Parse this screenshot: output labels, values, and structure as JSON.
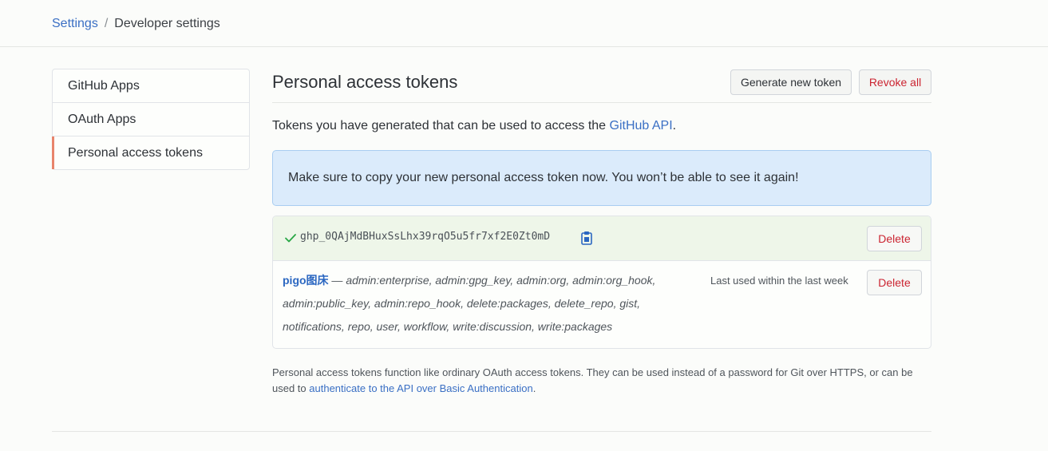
{
  "breadcrumb": {
    "parent": "Settings",
    "separator": "/",
    "current": "Developer settings"
  },
  "sidebar": {
    "items": [
      {
        "label": "GitHub Apps",
        "active": false
      },
      {
        "label": "OAuth Apps",
        "active": false
      },
      {
        "label": "Personal access tokens",
        "active": true
      }
    ]
  },
  "main": {
    "title": "Personal access tokens",
    "generate_button": "Generate new token",
    "revoke_all_button": "Revoke all",
    "intro_text": "Tokens you have generated that can be used to access the ",
    "intro_link": "GitHub API",
    "intro_end": ".",
    "flash_message": "Make sure to copy your new personal access token now. You won’t be able to see it again!",
    "new_token": {
      "value": "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",
      "delete_label": "Delete"
    },
    "token": {
      "name": "pigo图床",
      "dash": " — ",
      "scopes": "admin:enterprise, admin:gpg_key, admin:org, admin:org_hook, admin:public_key, admin:repo_hook, delete:packages, delete_repo, gist, notifications, repo, user, workflow, write:discussion, write:packages",
      "last_used": "Last used within the last week",
      "delete_label": "Delete"
    },
    "note_text": "Personal access tokens function like ordinary OAuth access tokens. They can be used instead of a password for Git over HTTPS, or can be used to ",
    "note_link": "authenticate to the API over Basic Authentication",
    "note_end": "."
  },
  "colors": {
    "link": "#3a6fc4",
    "danger": "#cb2431",
    "success": "#28a745",
    "flash_bg": "#dbebfb",
    "new_token_bg": "#eef6e9",
    "active_marker": "#e8846c"
  }
}
